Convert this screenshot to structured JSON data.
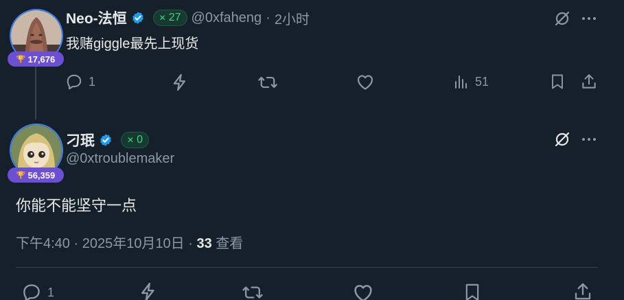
{
  "reply": {
    "display_name": "Neo-法恒",
    "score": "27",
    "handle": "@0xfaheng",
    "separator": "·",
    "time": "2小时",
    "text": "我赌giggle最先上现货",
    "rank": "17,676",
    "actions": {
      "replies": "1",
      "views": "51"
    }
  },
  "main": {
    "display_name": "刁珉",
    "score": "0",
    "handle": "@0xtroublemaker",
    "rank": "56,359",
    "text": "你能不能坚守一点",
    "timestamp": "下午4:40 · 2025年10月10日 · ",
    "views_count": "33",
    "views_label": " 查看",
    "actions": {
      "replies": "1"
    }
  },
  "colors": {
    "background": "#15202b",
    "verified": "#1d9bf0",
    "score_green": "#3fd18d",
    "rank_purple": "#6d4fd6"
  },
  "icons": [
    "verified-badge-icon",
    "grok-icon",
    "more-icon",
    "reply-icon",
    "boost-icon",
    "retweet-icon",
    "like-icon",
    "views-icon",
    "bookmark-icon",
    "share-icon",
    "trophy-icon"
  ]
}
